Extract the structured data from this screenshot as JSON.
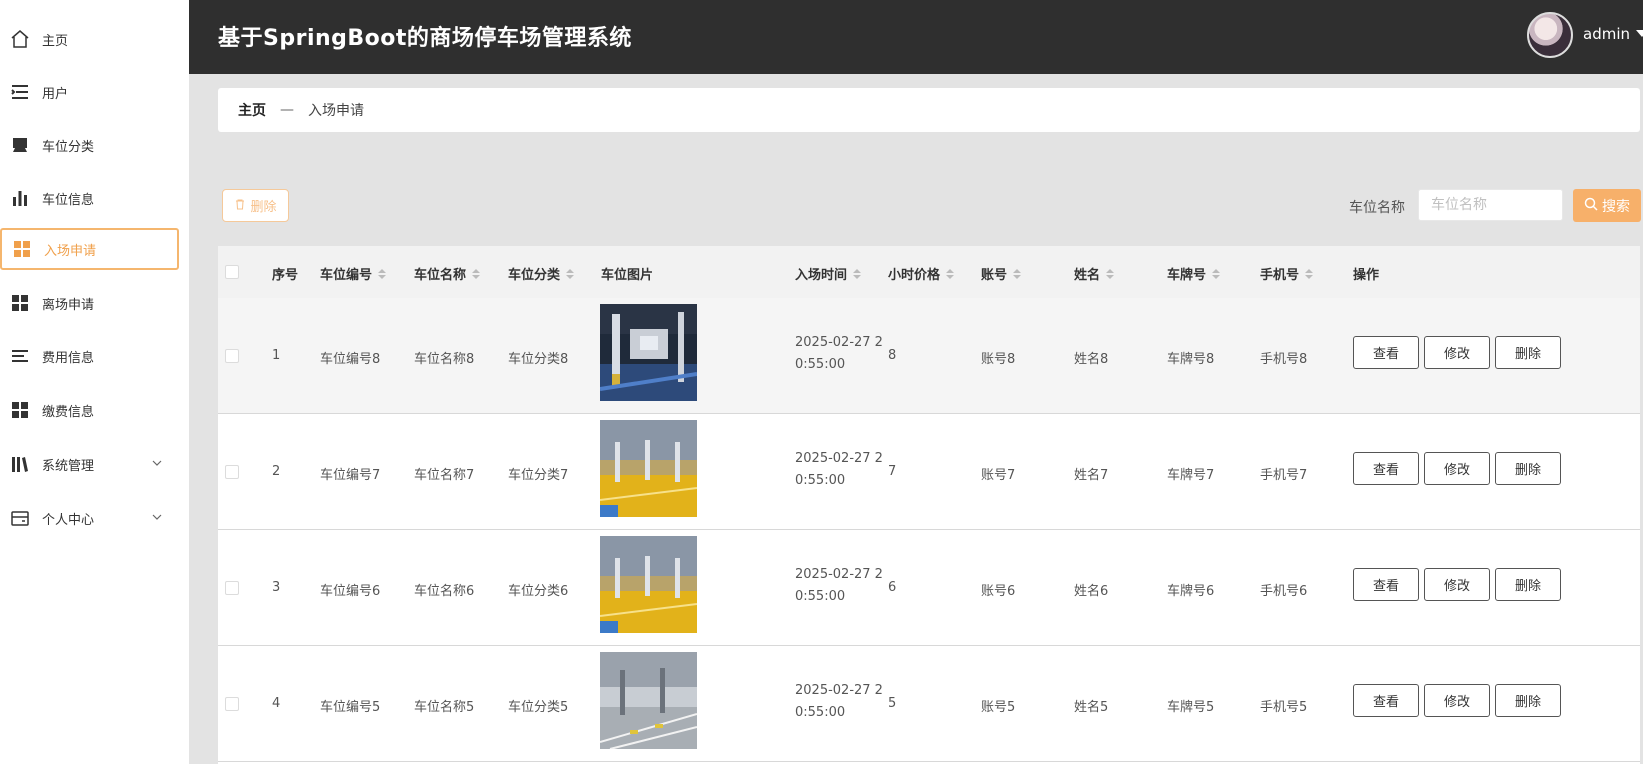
{
  "app": {
    "title": "基于SpringBoot的商场停车场管理系统",
    "user": "admin"
  },
  "sidebar": {
    "items": [
      {
        "label": "主页",
        "icon": "home-icon"
      },
      {
        "label": "用户",
        "icon": "list-icon"
      },
      {
        "label": "车位分类",
        "icon": "parking-icon"
      },
      {
        "label": "车位信息",
        "icon": "bar-chart-icon"
      },
      {
        "label": "入场申请",
        "icon": "grid-icon",
        "active": true
      },
      {
        "label": "离场申请",
        "icon": "grid-icon"
      },
      {
        "label": "费用信息",
        "icon": "lines-icon"
      },
      {
        "label": "缴费信息",
        "icon": "grid-icon"
      },
      {
        "label": "系统管理",
        "icon": "library-icon",
        "expandable": true
      },
      {
        "label": "个人中心",
        "icon": "card-icon",
        "expandable": true
      }
    ]
  },
  "breadcrumb": {
    "home": "主页",
    "separator": "—",
    "current": "入场申请"
  },
  "toolbar": {
    "delete_label": "删除",
    "search_label": "车位名称",
    "search_placeholder": "车位名称",
    "search_button": "搜索"
  },
  "table": {
    "columns": [
      "序号",
      "车位编号",
      "车位名称",
      "车位分类",
      "车位图片",
      "入场时间",
      "小时价格",
      "账号",
      "姓名",
      "车牌号",
      "手机号",
      "操作"
    ],
    "rows": [
      {
        "index": "1",
        "code": "车位编号8",
        "name": "车位名称8",
        "category": "车位分类8",
        "time": "2025-02-27 20:55:00",
        "price": "8",
        "account": "账号8",
        "person": "姓名8",
        "plate": "车牌号8",
        "phone": "手机号8"
      },
      {
        "index": "2",
        "code": "车位编号7",
        "name": "车位名称7",
        "category": "车位分类7",
        "time": "2025-02-27 20:55:00",
        "price": "7",
        "account": "账号7",
        "person": "姓名7",
        "plate": "车牌号7",
        "phone": "手机号7"
      },
      {
        "index": "3",
        "code": "车位编号6",
        "name": "车位名称6",
        "category": "车位分类6",
        "time": "2025-02-27 20:55:00",
        "price": "6",
        "account": "账号6",
        "person": "姓名6",
        "plate": "车牌号6",
        "phone": "手机号6"
      },
      {
        "index": "4",
        "code": "车位编号5",
        "name": "车位名称5",
        "category": "车位分类5",
        "time": "2025-02-27 20:55:00",
        "price": "5",
        "account": "账号5",
        "person": "姓名5",
        "plate": "车牌号5",
        "phone": "手机号5"
      }
    ],
    "actions": {
      "view": "查看",
      "edit": "修改",
      "delete": "删除"
    }
  },
  "colors": {
    "accent": "#f7b06a",
    "header_bg": "#2f2f2f",
    "active_border": "#f5b66e"
  }
}
